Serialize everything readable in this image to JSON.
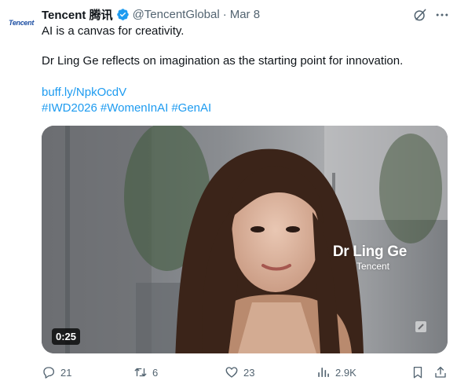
{
  "tweet": {
    "author": {
      "avatar_text": "Tencent",
      "name": "Tencent 腾讯",
      "handle": "@TencentGlobal",
      "separator": "·",
      "date": "Mar 8"
    },
    "text_line1": "AI is a canvas for creativity.",
    "text_line2": "Dr Ling Ge reflects on imagination as the starting point for innovation.",
    "link": "buff.ly/NpkOcdV",
    "hashtags": [
      "#IWD2026",
      "#WomenInAI",
      "#GenAI"
    ],
    "media": {
      "caption_name": "Dr Ling Ge",
      "caption_org": "Tencent",
      "duration": "0:25"
    },
    "actions": {
      "replies": "21",
      "reposts": "6",
      "likes": "23",
      "views": "2.9K"
    }
  },
  "colors": {
    "accent": "#1d9bf0",
    "text": "#0f1419",
    "secondary": "#536471",
    "brand": "#1d4fa3"
  },
  "icons": [
    "verified-badge-icon",
    "grok-icon",
    "more-icon",
    "reply-icon",
    "repost-icon",
    "like-icon",
    "views-icon",
    "bookmark-icon",
    "share-icon"
  ]
}
